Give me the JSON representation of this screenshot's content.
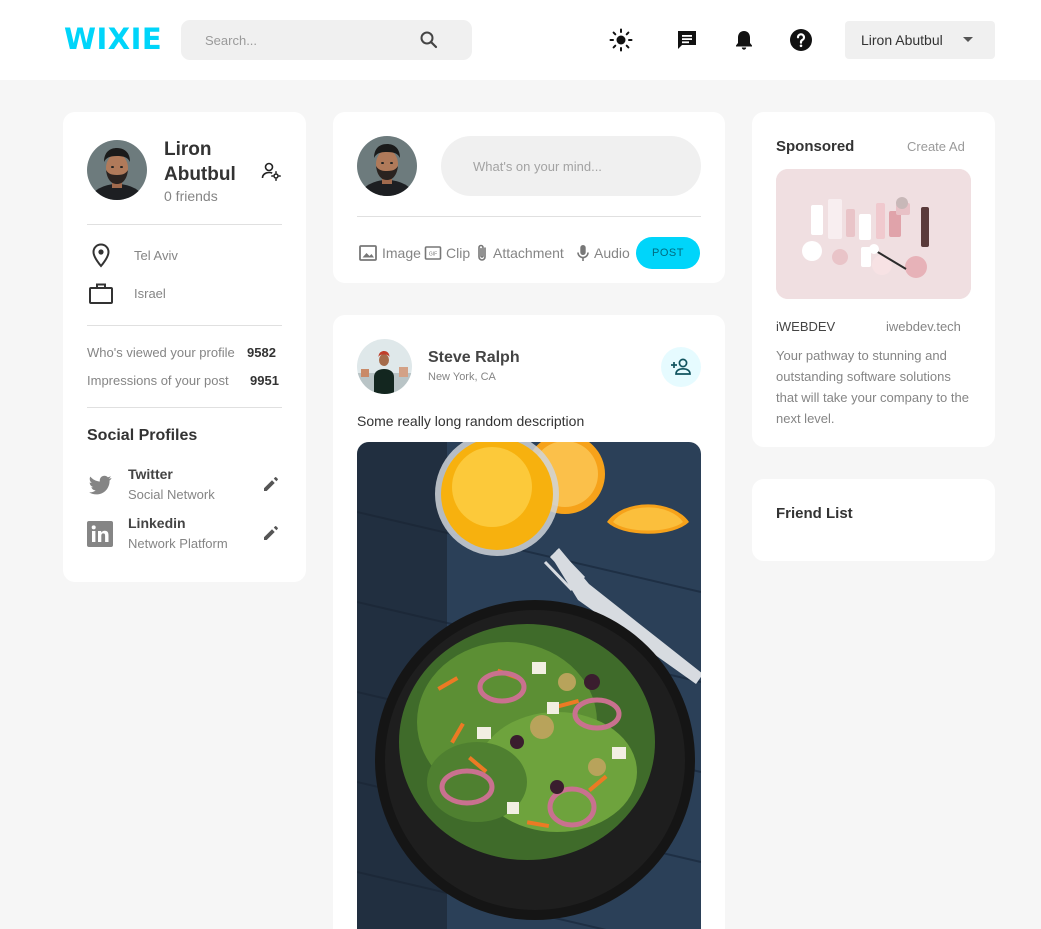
{
  "app": {
    "logo": "WIXIE"
  },
  "navbar": {
    "search_placeholder": "Search...",
    "icons": [
      "light-mode-icon",
      "message-icon",
      "notifications-icon",
      "help-icon"
    ],
    "user_name": "Liron Abutbul"
  },
  "profile": {
    "name": "Liron Abutbul",
    "friends": "0 friends",
    "location": "Tel Aviv",
    "occupation": "Israel",
    "stats": [
      {
        "label": "Who's viewed your profile",
        "value": "9582"
      },
      {
        "label": "Impressions of your post",
        "value": "9951"
      }
    ],
    "social_title": "Social Profiles",
    "social": [
      {
        "name": "Twitter",
        "sub": "Social Network",
        "icon": "twitter-icon"
      },
      {
        "name": "Linkedin",
        "sub": "Network Platform",
        "icon": "linkedin-icon"
      }
    ]
  },
  "composer": {
    "placeholder": "What's on your mind...",
    "tools": [
      {
        "label": "Image",
        "icon": "image-icon"
      },
      {
        "label": "Clip",
        "icon": "gif-icon"
      },
      {
        "label": "Attachment",
        "icon": "attachment-icon"
      },
      {
        "label": "Audio",
        "icon": "mic-icon"
      }
    ],
    "post_label": "POST"
  },
  "post": {
    "author": "Steve Ralph",
    "location": "New York, CA",
    "description": "Some really long random description"
  },
  "sponsored": {
    "title": "Sponsored",
    "create_ad": "Create Ad",
    "company": "iWEBDEV",
    "website": "iwebdev.tech",
    "description": "Your pathway to stunning and outstanding software solutions that will take your company to the next level."
  },
  "friend_list": {
    "title": "Friend List"
  },
  "colors": {
    "accent": "#00d5fa",
    "background": "#f6f6f6",
    "card": "#ffffff",
    "muted": "#858585"
  }
}
